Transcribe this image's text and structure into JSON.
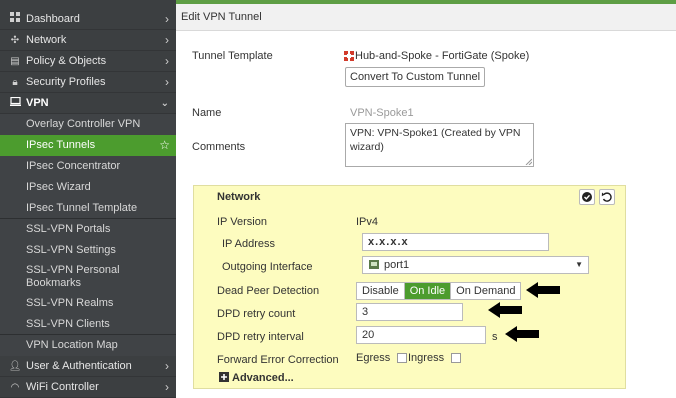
{
  "sidebar": {
    "items": [
      {
        "label": "Dashboard",
        "icon": "dashboard-icon"
      },
      {
        "label": "Network",
        "icon": "network-icon"
      },
      {
        "label": "Policy & Objects",
        "icon": "policy-icon"
      },
      {
        "label": "Security Profiles",
        "icon": "security-icon"
      },
      {
        "label": "VPN",
        "icon": "vpn-icon"
      }
    ],
    "vpn_sub": [
      "Overlay Controller VPN",
      "IPsec Tunnels",
      "IPsec Concentrator",
      "IPsec Wizard",
      "IPsec Tunnel Template",
      "SSL-VPN Portals",
      "SSL-VPN Settings",
      "SSL-VPN Personal Bookmarks",
      "SSL-VPN Realms",
      "SSL-VPN Clients",
      "VPN Location Map"
    ],
    "bottom": [
      {
        "label": "User & Authentication",
        "icon": "user-icon"
      },
      {
        "label": "WiFi Controller",
        "icon": "wifi-icon"
      }
    ]
  },
  "header": {
    "title": "Edit VPN Tunnel"
  },
  "form": {
    "tunnel_template_label": "Tunnel Template",
    "tunnel_template_value": "Hub-and-Spoke - FortiGate (Spoke)",
    "convert_button": "Convert To Custom Tunnel",
    "name_label": "Name",
    "name_value": "VPN-Spoke1",
    "comments_label": "Comments",
    "comments_value": "VPN: VPN-Spoke1 (Created by VPN wizard)"
  },
  "network": {
    "title": "Network",
    "ip_version_label": "IP Version",
    "ip_version_value": "IPv4",
    "ip_address_label": "IP Address",
    "ip_address_value": "x.x.x.x",
    "outgoing_label": "Outgoing Interface",
    "outgoing_value": "port1",
    "dpd_label": "Dead Peer Detection",
    "dpd_options": [
      "Disable",
      "On Idle",
      "On Demand"
    ],
    "dpd_selected": "On Idle",
    "retry_count_label": "DPD retry count",
    "retry_count_value": "3",
    "retry_interval_label": "DPD retry interval",
    "retry_interval_value": "20",
    "retry_interval_unit": "s",
    "fec_label": "Forward Error Correction",
    "fec_egress": "Egress",
    "fec_ingress": "Ingress",
    "advanced_label": "Advanced..."
  },
  "colors": {
    "accent": "#4c9c2e",
    "sidebar_bg": "#3c3f41",
    "panel_bg": "#fdfcbf"
  }
}
